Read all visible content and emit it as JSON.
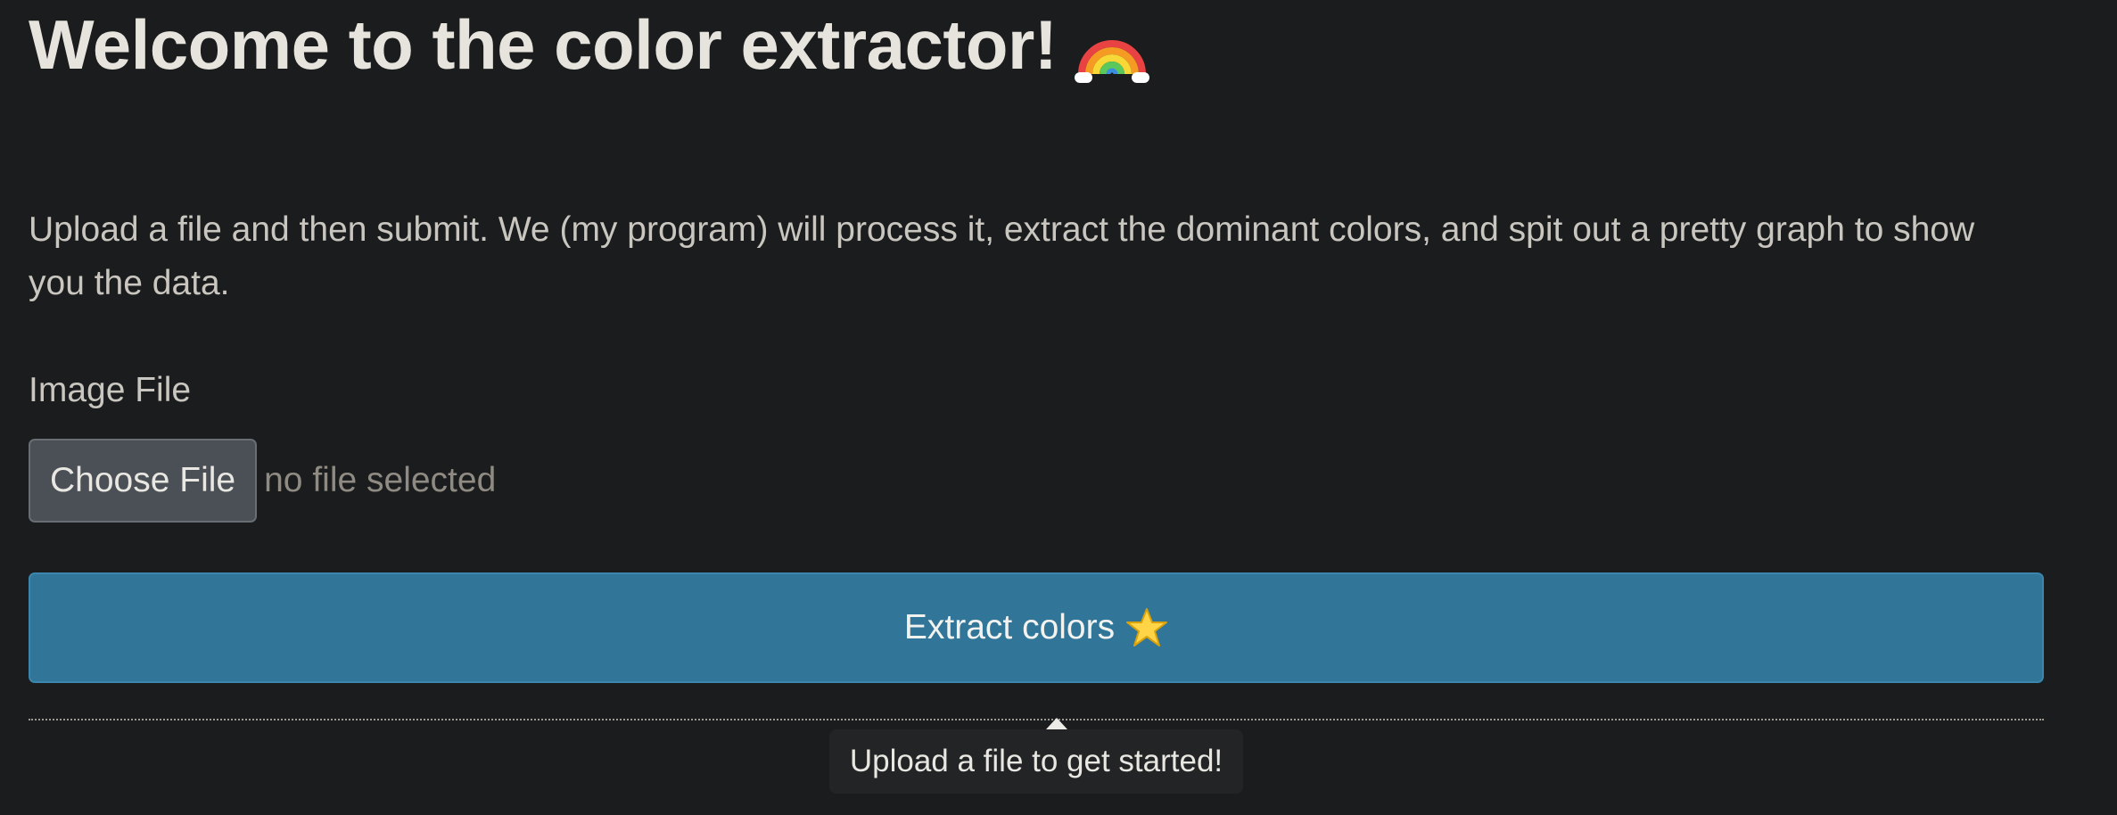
{
  "header": {
    "title": "Welcome to the color extractor!",
    "title_icon": "rainbow-icon"
  },
  "intro": {
    "text": "Upload a file and then submit. We (my program) will process it, extract the dominant colors, and spit out a pretty graph to show you the data."
  },
  "upload": {
    "label": "Image File",
    "button_label": "Choose File",
    "status": "no file selected"
  },
  "submit": {
    "label": "Extract colors",
    "icon": "star-icon"
  },
  "tooltip": {
    "text": "Upload a file to get started!"
  },
  "colors": {
    "background": "#1b1c1e",
    "accent": "#317599",
    "file_button": "#4a5056",
    "tooltip_background": "#222426"
  }
}
